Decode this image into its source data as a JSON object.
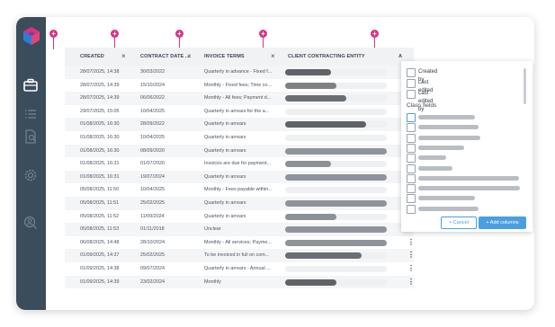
{
  "columns": {
    "created": "CREATED",
    "contract_date": "CONTRACT DATE ...",
    "invoice_terms": "INVOICE TERMS",
    "client_entity": "CLIENT CONTRACTING ENTITY",
    "fifth": "A"
  },
  "rows": [
    {
      "created": "28/07/2025, 14:38",
      "contract": "30/03/2022",
      "terms": "Quarterly in advance - Fixed f...",
      "entity_fill": 0.45,
      "more": ""
    },
    {
      "created": "28/07/2025, 14:39",
      "contract": "15/10/2024",
      "terms": "Monthly - Fixed fees; Time co...",
      "entity_fill": 0.5,
      "more": ""
    },
    {
      "created": "28/07/2025, 14:39",
      "contract": "06/06/2022",
      "terms": "Monthly - All fees; Payment d...",
      "entity_fill": 0.6,
      "more": ""
    },
    {
      "created": "29/07/2025, 15:05",
      "contract": "10/04/2025",
      "terms": "Quarterly in arrears for the a...",
      "entity_fill": 0.0,
      "more": ""
    },
    {
      "created": "01/08/2025, 16:30",
      "contract": "28/09/2022",
      "terms": "Quarterly in arrears",
      "entity_fill": 0.8,
      "more": ""
    },
    {
      "created": "01/08/2025, 16:30",
      "contract": "10/04/2025",
      "terms": "Quarterly in arrears",
      "entity_fill": 0.0,
      "more": ""
    },
    {
      "created": "01/08/2025, 16:30",
      "contract": "08/09/2020",
      "terms": "Quarterly in arrears",
      "entity_fill": 1.0,
      "more": ""
    },
    {
      "created": "01/08/2025, 16:31",
      "contract": "01/07/2020",
      "terms": "Invoices are due for payment...",
      "entity_fill": 0.45,
      "more": ""
    },
    {
      "created": "01/08/2025, 16:31",
      "contract": "19/07/2024",
      "terms": "Quarterly in arrears",
      "entity_fill": 1.0,
      "more": ""
    },
    {
      "created": "05/08/2025, 11:50",
      "contract": "10/04/2025",
      "terms": "Monthly - Fees payable within...",
      "entity_fill": 0.0,
      "more": ""
    },
    {
      "created": "05/08/2025, 11:51",
      "contract": "25/02/2025",
      "terms": "Quarterly in arrears",
      "entity_fill": 1.0,
      "more": ""
    },
    {
      "created": "05/08/2025, 11:52",
      "contract": "11/09/2024",
      "terms": "Quarterly in arrears",
      "entity_fill": 0.5,
      "more": ""
    },
    {
      "created": "05/08/2025, 11:53",
      "contract": "01/11/2018",
      "terms": "Unclear",
      "entity_fill": 1.0,
      "more": "⋮"
    },
    {
      "created": "06/08/2025, 14:48",
      "contract": "28/10/2024",
      "terms": "Monthly - All services; Payme...",
      "entity_fill": 1.0,
      "more": "⋮"
    },
    {
      "created": "01/09/2025, 14:37",
      "contract": "25/02/2025",
      "terms": "To be invoiced in full on com...",
      "entity_fill": 0.75,
      "more": "⋮"
    },
    {
      "created": "01/09/2025, 14:38",
      "contract": "09/07/2024",
      "terms": "Quarterly in arrears - Annual ...",
      "entity_fill": 0.0,
      "more": "⋮"
    },
    {
      "created": "01/09/2025, 14:39",
      "contract": "23/02/2024",
      "terms": "Monthly",
      "entity_fill": 0.5,
      "more": "⋮"
    }
  ],
  "panel": {
    "options": [
      "Created by",
      "Last edited",
      "Last edited by"
    ],
    "section_title": "Class fields",
    "class_field_count": 10,
    "cancel_label": "× Cancel",
    "add_label": "+ Add columns"
  },
  "colors": {
    "sidebar": "#3b4d5b",
    "accent_pink": "#d63384",
    "accent_blue": "#4a9fe0"
  }
}
